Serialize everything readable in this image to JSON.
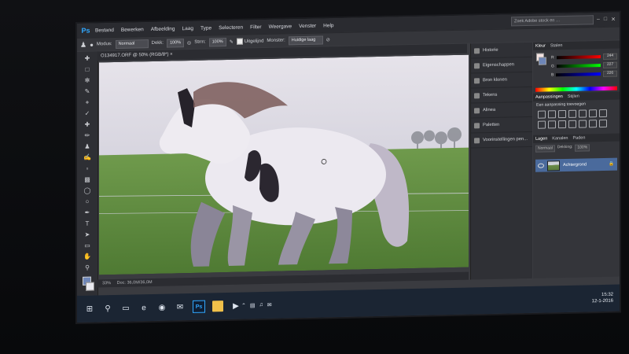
{
  "app": {
    "logo": "Ps",
    "menu": [
      "Bestand",
      "Bewerken",
      "Afbeelding",
      "Laag",
      "Type",
      "Selecteren",
      "Filter",
      "Weergave",
      "Venster",
      "Help"
    ],
    "search_placeholder": "Zoek Adobe stock en …"
  },
  "options_bar": {
    "modus_label": "Modus:",
    "modus_value": "Normaal",
    "dekking_label": "Dekk:",
    "dekking_value": "100%",
    "stroom_label": "Strm:",
    "stroom_value": "100%",
    "uitgelijnd_label": "Uitgelijnd",
    "monster_label": "Monster:",
    "monster_value": "Huidige laag"
  },
  "document": {
    "tab_title": "O134917.ORF @ 50% (RGB/8*)",
    "status_zoom": "33%",
    "status_doc": "Doc: 36,0M/36,0M"
  },
  "collapsed_panels": [
    "Historie",
    "Eigenschappen",
    "Bron klonen",
    "Tekens",
    "Alinea",
    "Paletten",
    "Voorinstellingen pen..."
  ],
  "color_panel": {
    "tabs": [
      "Kleur",
      "Stalen"
    ],
    "r": "244",
    "g": "227",
    "b": "226"
  },
  "adjustments_panel": {
    "tabs": [
      "Aanpassingen",
      "Stijlen"
    ],
    "title": "Een aanpassing toevoegen"
  },
  "layers_panel": {
    "tabs": [
      "Lagen",
      "Kanalen",
      "Paden"
    ],
    "blend": "Normaal",
    "opacity_label": "Dekking:",
    "opacity": "100%",
    "layer_name": "Achtergrond"
  },
  "taskbar": {
    "time": "15:32",
    "date": "12-1-2016"
  },
  "colors": {
    "accent": "#31a8ff",
    "ui_dark": "#2a2b30",
    "selection": "#4a6a9c"
  }
}
